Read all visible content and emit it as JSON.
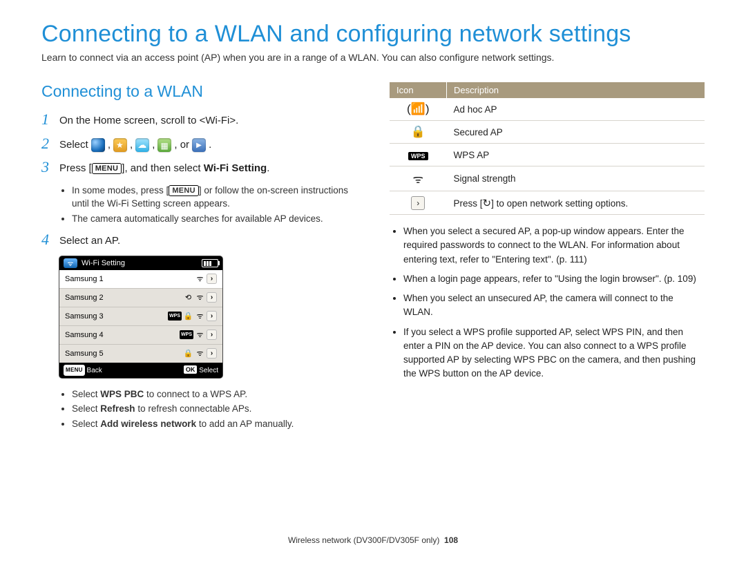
{
  "page_title": "Connecting to a WLAN and configuring network settings",
  "intro": "Learn to connect via an access point (AP) when you are in a range of a WLAN. You can also configure network settings.",
  "section_title": "Connecting to a WLAN",
  "steps": {
    "s1": "On the Home screen, scroll to <Wi-Fi>.",
    "s2_a": "Select ",
    "s2_b": ", or ",
    "s2_c": ".",
    "s3_a": "Press [",
    "s3_b": "], and then select ",
    "s3_c": "Wi-Fi Setting",
    "s3_sub1_a": "In some modes, press [",
    "s3_sub1_b": "] or follow the on-screen instructions until the Wi-Fi Setting screen appears.",
    "s3_sub2": "The camera automatically searches for available AP devices.",
    "s4": "Select an AP."
  },
  "camera": {
    "title": "Wi-Fi Setting",
    "rows": [
      "Samsung 1",
      "Samsung 2",
      "Samsung 3",
      "Samsung 4",
      "Samsung 5"
    ],
    "back": "Back",
    "select": "Select",
    "menu": "MENU",
    "ok": "OK"
  },
  "after_bullets": {
    "b1_a": "Select ",
    "b1_b": "WPS PBC",
    "b1_c": " to connect to a WPS AP.",
    "b2_a": "Select ",
    "b2_b": "Refresh",
    "b2_c": " to refresh connectable APs.",
    "b3_a": "Select ",
    "b3_b": "Add wireless network",
    "b3_c": " to add an AP manually."
  },
  "icon_table": {
    "h_icon": "Icon",
    "h_desc": "Description",
    "r1": "Ad hoc AP",
    "r2": "Secured AP",
    "r3": "WPS AP",
    "r4": "Signal strength",
    "r5_a": "Press [",
    "r5_b": "] to open network setting options.",
    "wps": "WPS"
  },
  "right_bullets": {
    "b1": "When you select a secured AP, a pop-up window appears. Enter the required passwords to connect to the WLAN. For information about entering text, refer to \"Entering text\". (p. 111)",
    "b2": "When a login page appears, refer to \"Using the login browser\". (p. 109)",
    "b3": "When you select an unsecured AP, the camera will connect to the WLAN.",
    "b4_a": "If you select a WPS profile supported AP, select ",
    "b4_b": "WPS PIN",
    "b4_c": ", and then enter a PIN on the AP device. You can also connect to a WPS profile supported AP by selecting ",
    "b4_d": "WPS PBC",
    "b4_e": " on the camera, and then pushing the ",
    "b4_f": "WPS",
    "b4_g": " button on the AP device."
  },
  "footer": {
    "text": "Wireless network (DV300F/DV305F only)",
    "page": "108"
  }
}
